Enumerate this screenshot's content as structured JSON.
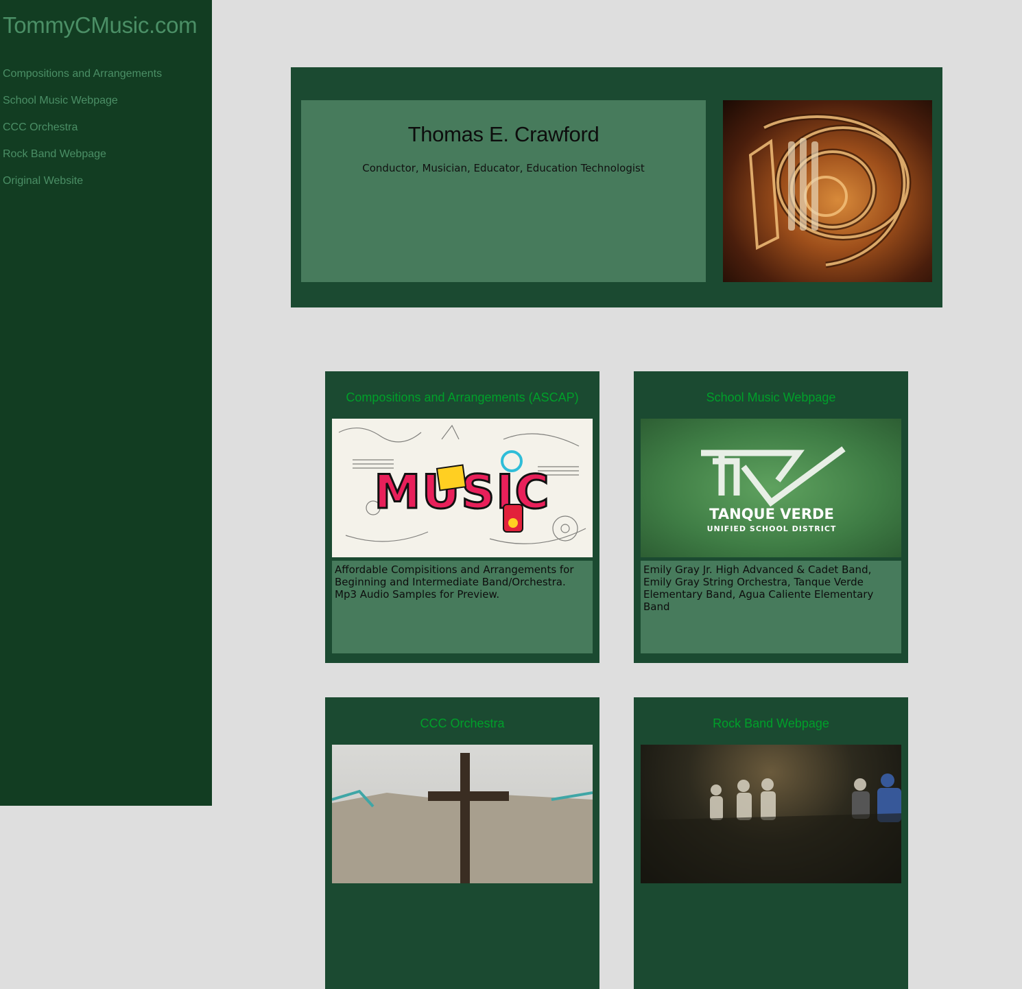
{
  "site": {
    "title": "TommyCMusic.com"
  },
  "nav": {
    "items": [
      {
        "label": "Compositions and Arrangements"
      },
      {
        "label": "School Music Webpage"
      },
      {
        "label": "CCC Orchestra"
      },
      {
        "label": "Rock Band Webpage"
      },
      {
        "label": "Original Website"
      }
    ]
  },
  "hero": {
    "name": "Thomas E. Crawford",
    "subtitle": "Conductor, Musician, Educator, Education Technologist",
    "image_icon": "french-horn-image"
  },
  "cards": [
    {
      "title": "Compositions and Arrangements (ASCAP)",
      "description": "Affordable Compisitions and Arrangements for Beginning and Intermediate Band/Orchestra. Mp3 Audio Samples for Preview.",
      "image_text": "MUSIC",
      "image_icon": "music-doodle-image"
    },
    {
      "title": "School Music Webpage",
      "description": "Emily Gray Jr. High Advanced & Cadet Band, Emily Gray String Orchestra, Tanque Verde Elementary Band, Agua Caliente Elementary Band",
      "logo_name": "TANQUE VERDE",
      "logo_sub": "UNIFIED SCHOOL DISTRICT",
      "image_icon": "tanque-verde-logo"
    },
    {
      "title": "CCC Orchestra",
      "image_icon": "cross-photo"
    },
    {
      "title": "Rock Band Webpage",
      "image_icon": "band-photo"
    }
  ],
  "colors": {
    "sidebar_bg": "#123d22",
    "panel_bg": "#1b4a31",
    "panel_inner": "#477b5c",
    "link_green": "#00a02a",
    "nav_text": "#4b8f66",
    "page_bg": "#dedede"
  }
}
